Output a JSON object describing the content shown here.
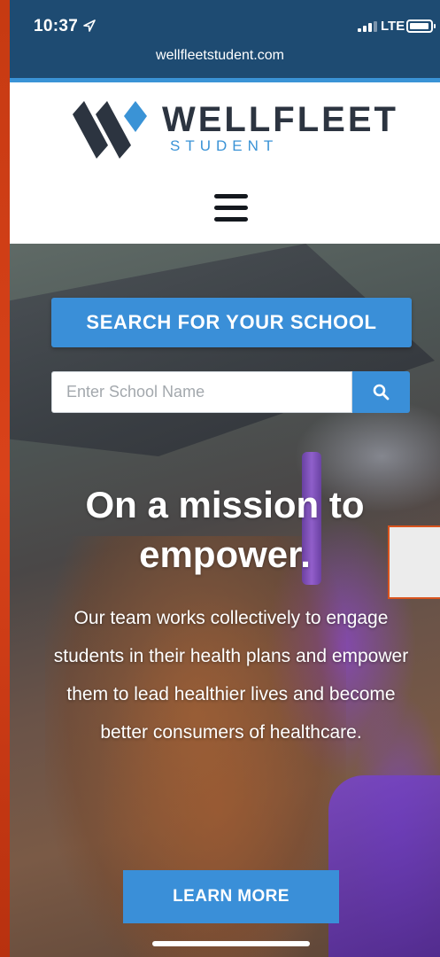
{
  "status_bar": {
    "time": "10:37",
    "network": "LTE"
  },
  "browser": {
    "url": "wellfleetstudent.com"
  },
  "header": {
    "brand_name": "WELLFLEET",
    "brand_sub": "STUDENT",
    "brand_colors": {
      "dark": "#2c3440",
      "blue": "#3a93d6"
    }
  },
  "search": {
    "title": "SEARCH FOR YOUR SCHOOL",
    "placeholder": "Enter School Name",
    "value": ""
  },
  "hero": {
    "headline": "On a mission to empower.",
    "description": "Our team works collectively to engage students in their health plans and empower them to lead healthier lives and become better consumers of healthcare.",
    "cta_label": "LEARN MORE"
  },
  "icons": [
    "location-arrow-icon",
    "signal-icon",
    "battery-icon",
    "wellfleet-logo",
    "hamburger-menu-icon",
    "search-icon"
  ]
}
